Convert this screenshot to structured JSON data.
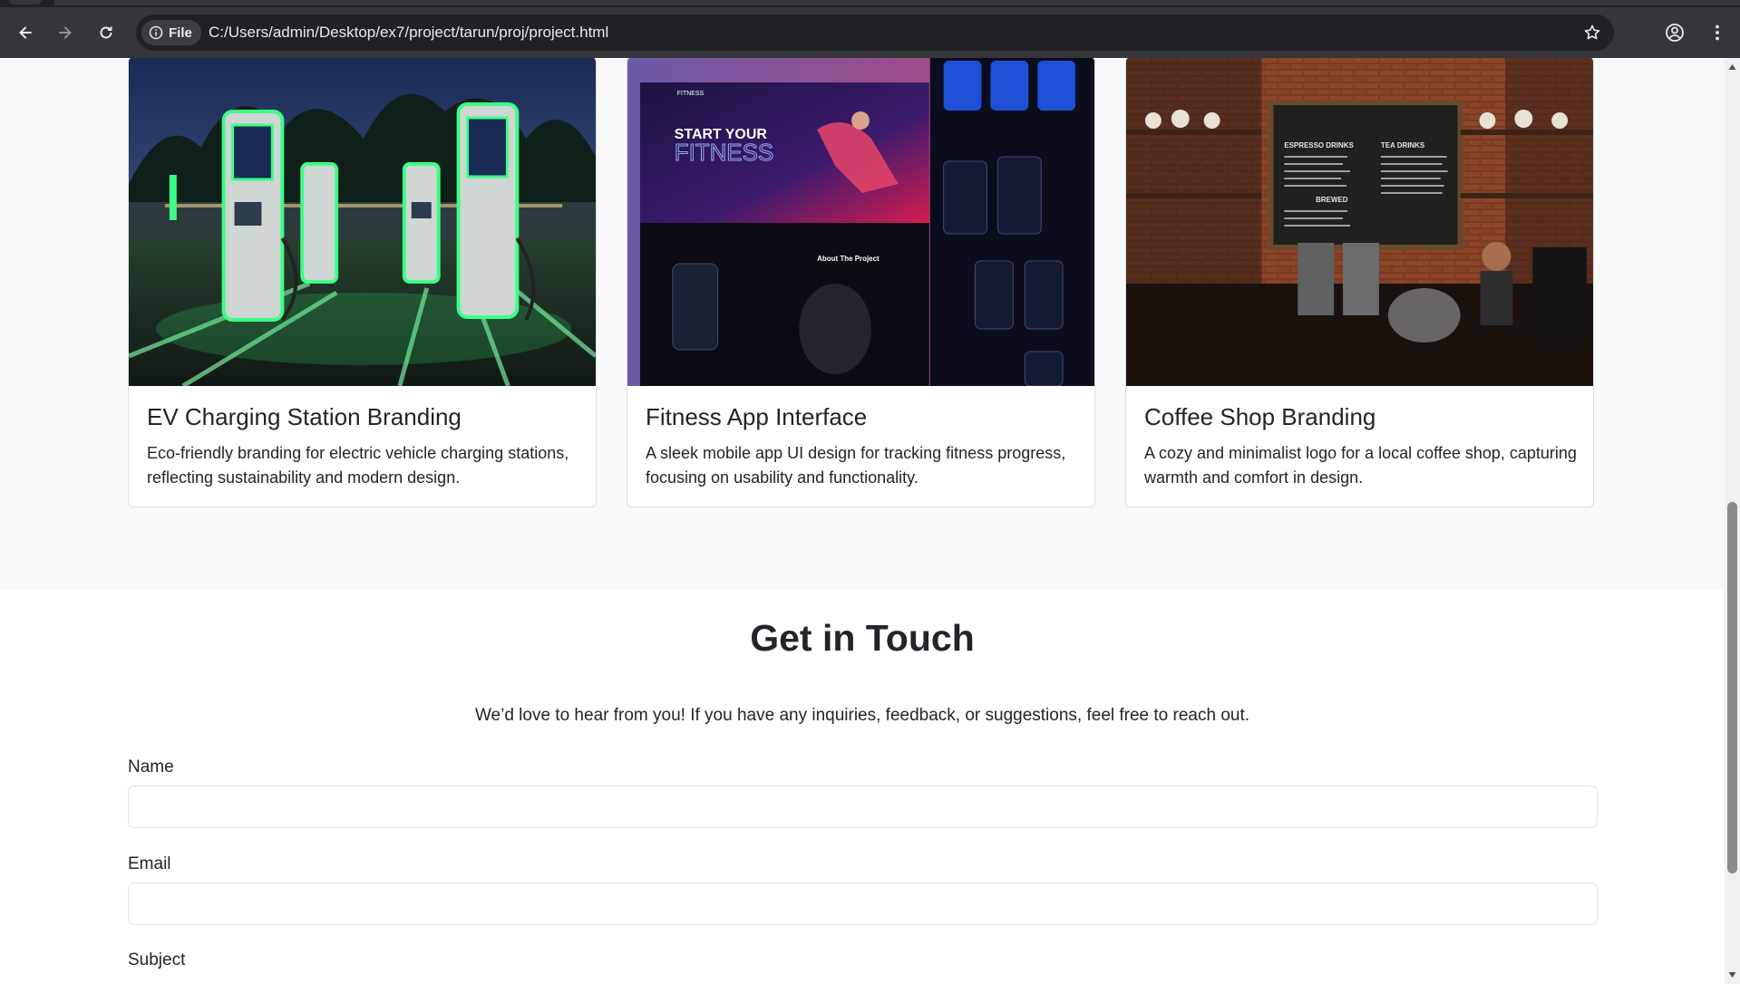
{
  "browser": {
    "file_chip_label": "File",
    "url": "C:/Users/admin/Desktop/ex7/project/tarun/proj/project.html"
  },
  "projects": [
    {
      "title": "EV Charging Station Branding",
      "description": "Eco-friendly branding for electric vehicle charging stations, reflecting sustainability and modern design."
    },
    {
      "title": "Fitness App Interface",
      "description": "A sleek mobile app UI design for tracking fitness progress, focusing on usability and functionality.",
      "image_text": {
        "brand": "FITNESS",
        "headline_1": "START YOUR",
        "headline_2": "FITNESS",
        "about_heading": "About The Project"
      }
    },
    {
      "title": "Coffee Shop Branding",
      "description": "A cozy and minimalist logo for a local coffee shop, capturing warmth and comfort in design.",
      "image_text": {
        "menu_left": "ESPRESSO DRINKS",
        "menu_right": "TEA DRINKS",
        "menu_brewed": "BREWED"
      }
    }
  ],
  "contact": {
    "heading": "Get in Touch",
    "intro": "We’d love to hear from you! If you have any inquiries, feedback, or suggestions, feel free to reach out.",
    "fields": {
      "name_label": "Name",
      "name_value": "",
      "email_label": "Email",
      "email_value": "",
      "subject_label": "Subject"
    }
  }
}
